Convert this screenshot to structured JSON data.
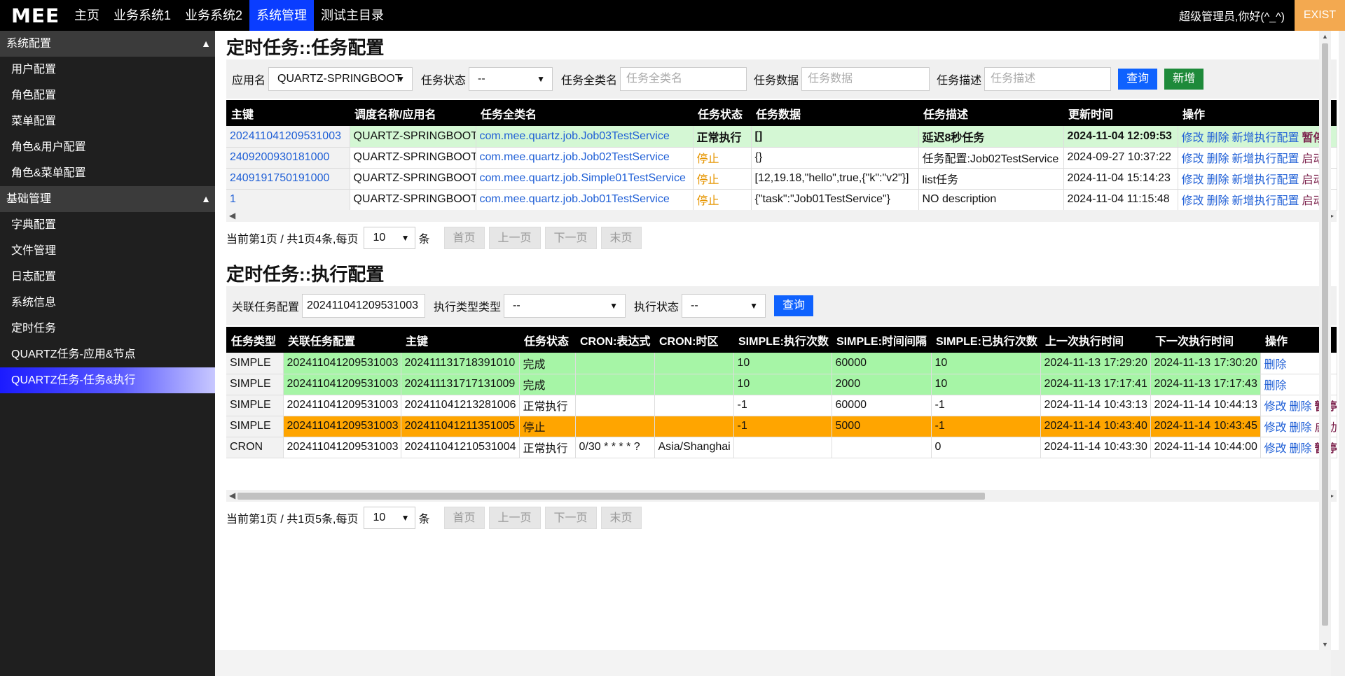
{
  "topbar": {
    "logo": "MEE",
    "nav": [
      "主页",
      "业务系统1",
      "业务系统2",
      "系统管理",
      "测试主目录"
    ],
    "user": "超级管理员,你好(^_^)",
    "exit": "EXIST"
  },
  "sidebar": {
    "groups": [
      {
        "title": "系统配置",
        "items": [
          "用户配置",
          "角色配置",
          "菜单配置",
          "角色&用户配置",
          "角色&菜单配置"
        ]
      },
      {
        "title": "基础管理",
        "items": [
          "字典配置",
          "文件管理",
          "日志配置",
          "系统信息",
          "定时任务",
          "QUARTZ任务-应用&节点",
          "QUARTZ任务-任务&执行"
        ]
      }
    ],
    "arrow": "▲"
  },
  "section1": {
    "title": "定时任务::任务配置",
    "filter": {
      "app_label": "应用名",
      "app_value": "QUARTZ-SPRINGBOOT",
      "status_label": "任务状态",
      "status_value": "--",
      "class_label": "任务全类名",
      "class_placeholder": "任务全类名",
      "data_label": "任务数据",
      "data_placeholder": "任务数据",
      "desc_label": "任务描述",
      "desc_placeholder": "任务描述",
      "query": "查询",
      "add": "新增"
    },
    "headers": [
      "主键",
      "调度名称/应用名",
      "任务全类名",
      "任务状态",
      "任务数据",
      "任务描述",
      "更新时间",
      "操作"
    ],
    "rows": [
      [
        "202411041209531003",
        "QUARTZ-SPRINGBOOT",
        "com.mee.quartz.job.Job03TestService",
        "正常执行",
        "[]",
        "延迟8秒任务",
        "2024-11-04 12:09:53"
      ],
      [
        "2409200930181000",
        "QUARTZ-SPRINGBOOT",
        "com.mee.quartz.job.Job02TestService",
        "停止",
        "{}",
        "任务配置:Job02TestService",
        "2024-09-27 10:37:22"
      ],
      [
        "2409191750191000",
        "QUARTZ-SPRINGBOOT",
        "com.mee.quartz.job.Simple01TestService",
        "停止",
        "[12,19.18,\"hello\",true,{\"k\":\"v2\"}]",
        "list任务",
        "2024-11-04 15:14:23"
      ],
      [
        "1",
        "QUARTZ-SPRINGBOOT",
        "com.mee.quartz.job.Job01TestService",
        "停止",
        "{\"task\":\"Job01TestService\"}",
        "NO description",
        "2024-11-04 11:15:48"
      ]
    ],
    "ops": [
      [
        "修改",
        "删除",
        "新增执行配置",
        "暂停"
      ],
      [
        "修改",
        "删除",
        "新增执行配置",
        "启动"
      ],
      [
        "修改",
        "删除",
        "新增执行配置",
        "启动"
      ],
      [
        "修改",
        "删除",
        "新增执行配置",
        "启动"
      ]
    ],
    "row_colors": [
      "#d4f7d4",
      "#ffffff",
      "#ffffff",
      "#ffffff"
    ],
    "pager": {
      "text": "当前第1页 / 共1页4条,每页",
      "size": "10",
      "unit": "条",
      "first": "首页",
      "prev": "上一页",
      "next": "下一页",
      "last": "末页"
    }
  },
  "section2": {
    "title": "定时任务::执行配置",
    "filter": {
      "related_label": "关联任务配置",
      "related_value": "202411041209531003",
      "type_label": "执行类型类型",
      "type_value": "--",
      "status_label": "执行状态",
      "status_value": "--",
      "query": "查询"
    },
    "headers": [
      "任务类型",
      "关联任务配置",
      "主键",
      "任务状态",
      "CRON:表达式",
      "CRON:时区",
      "SIMPLE:执行次数",
      "SIMPLE:时间间隔",
      "SIMPLE:已执行次数",
      "上一次执行时间",
      "下一次执行时间",
      "操作"
    ],
    "rows": [
      [
        "SIMPLE",
        "202411041209531003",
        "202411131718391010",
        "完成",
        "",
        "",
        "10",
        "60000",
        "10",
        "2024-11-13 17:29:20",
        "2024-11-13 17:30:20"
      ],
      [
        "SIMPLE",
        "202411041209531003",
        "202411131717131009",
        "完成",
        "",
        "",
        "10",
        "2000",
        "10",
        "2024-11-13 17:17:41",
        "2024-11-13 17:17:43"
      ],
      [
        "SIMPLE",
        "202411041209531003",
        "202411041213281006",
        "正常执行",
        "",
        "",
        "-1",
        "60000",
        "-1",
        "2024-11-14 10:43:13",
        "2024-11-14 10:44:13"
      ],
      [
        "SIMPLE",
        "202411041209531003",
        "202411041211351005",
        "停止",
        "",
        "",
        "-1",
        "5000",
        "-1",
        "2024-11-14 10:43:40",
        "2024-11-14 10:43:45"
      ],
      [
        "CRON",
        "202411041209531003",
        "202411041210531004",
        "正常执行",
        "0/30 * * * * ?",
        "Asia/Shanghai",
        "",
        "",
        "0",
        "2024-11-14 10:43:30",
        "2024-11-14 10:44:00"
      ]
    ],
    "ops": [
      [
        "删除"
      ],
      [
        "删除"
      ],
      [
        "修改",
        "删除",
        "暂停"
      ],
      [
        "修改",
        "删除",
        "启动"
      ],
      [
        "修改",
        "删除",
        "暂停"
      ]
    ],
    "row_colors": [
      "#a6f5a6",
      "#a6f5a6",
      "#ffffff",
      "#ffa500",
      "#ffffff"
    ],
    "pager": {
      "text": "当前第1页 / 共1页5条,每页",
      "size": "10",
      "unit": "条",
      "first": "首页",
      "prev": "上一页",
      "next": "下一页",
      "last": "末页"
    }
  },
  "colors": {
    "active_nav": "#0a3dff",
    "exit_bg": "#f3a950",
    "link": "#1f5fd6",
    "stop": "#e69500"
  }
}
